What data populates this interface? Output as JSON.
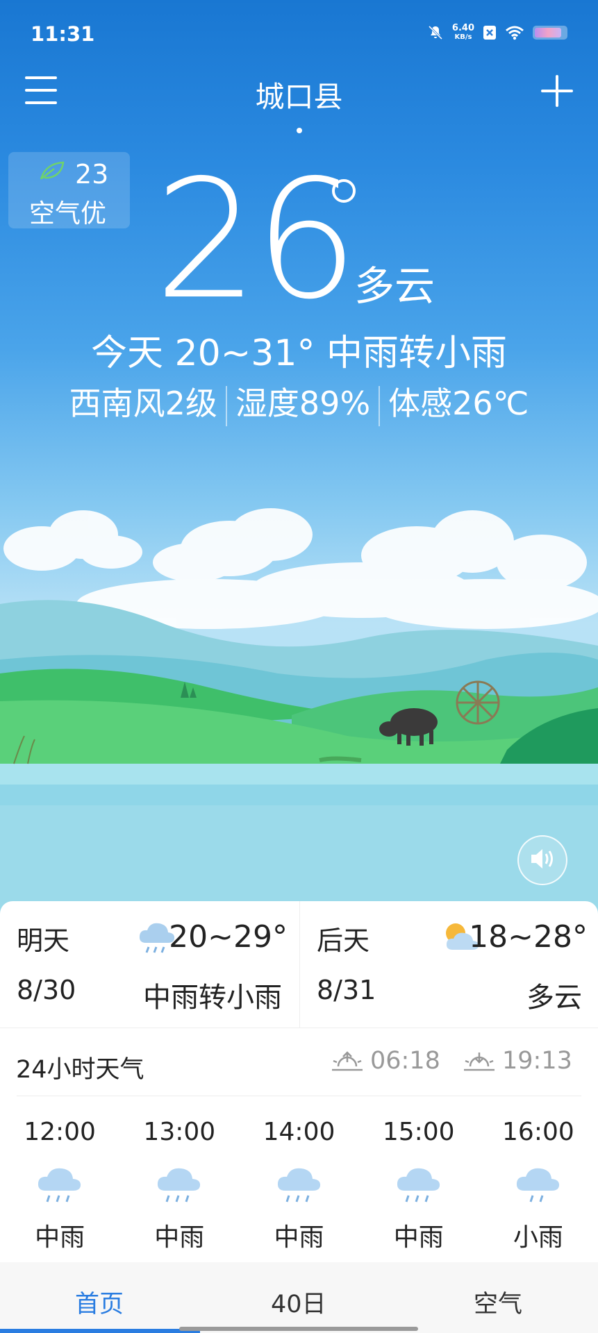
{
  "status_bar": {
    "time": "11:31",
    "net_speed": "6.40",
    "net_unit": "KB/s",
    "icons": [
      "silent-icon",
      "data-saver-icon",
      "wifi-icon",
      "battery-icon"
    ]
  },
  "header": {
    "menu_icon": "menu-icon",
    "city": "城口县",
    "add_icon": "add-icon"
  },
  "air_quality": {
    "icon": "leaf-icon",
    "value": "23",
    "text": "空气优"
  },
  "current": {
    "temperature": "26",
    "condition": "多云",
    "today_summary": "今天 20~31° 中雨转小雨",
    "wind": "西南风2级",
    "humidity": "湿度89%",
    "feels_like": "体感26℃"
  },
  "forecast": [
    {
      "label": "明天",
      "date": "8/30",
      "range": "20~29°",
      "desc": "中雨转小雨",
      "icon": "rain-cloud-icon"
    },
    {
      "label": "后天",
      "date": "8/31",
      "range": "18~28°",
      "desc": "多云",
      "icon": "partly-cloudy-icon"
    }
  ],
  "hourly": {
    "title": "24小时天气",
    "sunrise": "06:18",
    "sunset": "19:13",
    "items": [
      {
        "time": "12:00",
        "desc": "中雨"
      },
      {
        "time": "13:00",
        "desc": "中雨"
      },
      {
        "time": "14:00",
        "desc": "中雨"
      },
      {
        "time": "15:00",
        "desc": "中雨"
      },
      {
        "time": "16:00",
        "desc": "小雨"
      }
    ]
  },
  "tabs": [
    "首页",
    "40日",
    "空气"
  ],
  "colors": {
    "accent": "#2a7de1",
    "sky_top": "#1977d2",
    "sky_bottom": "#b9e2f6"
  }
}
